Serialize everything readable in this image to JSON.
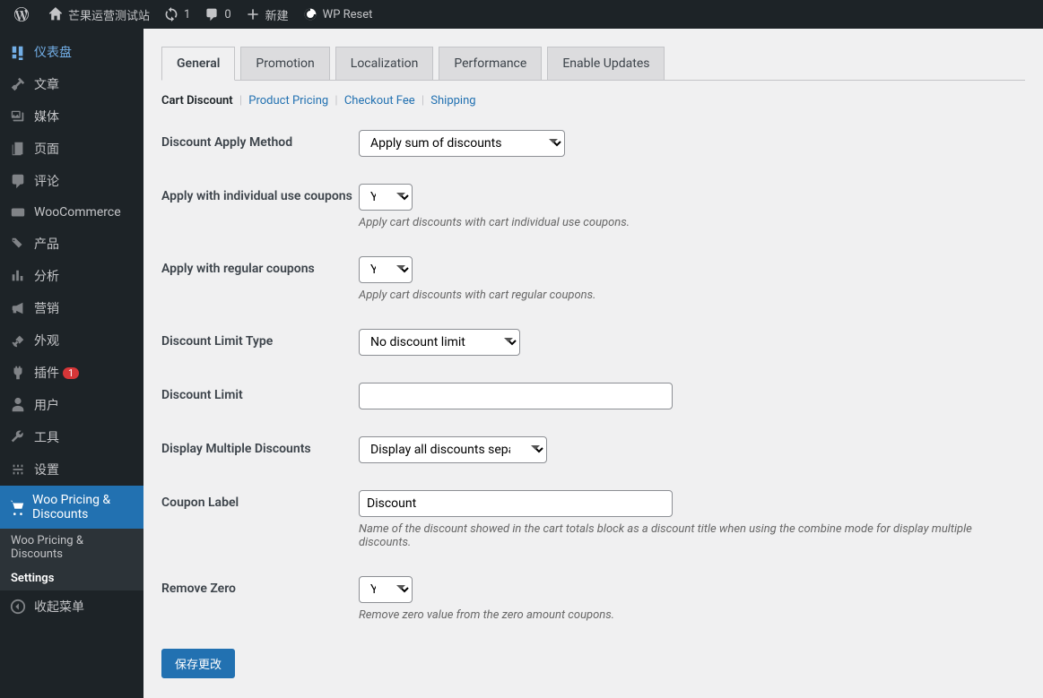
{
  "topbar": {
    "site_name": "芒果运营测试站",
    "updates_count": "1",
    "comments_count": "0",
    "new_label": "新建",
    "wp_reset": "WP Reset"
  },
  "sidebar": {
    "items": [
      {
        "label": "仪表盘"
      },
      {
        "label": "文章"
      },
      {
        "label": "媒体"
      },
      {
        "label": "页面"
      },
      {
        "label": "评论"
      },
      {
        "label": "WooCommerce"
      },
      {
        "label": "产品"
      },
      {
        "label": "分析"
      },
      {
        "label": "营销"
      },
      {
        "label": "外观"
      },
      {
        "label": "插件"
      },
      {
        "label": "用户"
      },
      {
        "label": "工具"
      },
      {
        "label": "设置"
      },
      {
        "label": "Woo Pricing & Discounts"
      }
    ],
    "plugins_badge": "1",
    "submenu": [
      {
        "label": "Woo Pricing & Discounts"
      },
      {
        "label": "Settings"
      }
    ],
    "collapse": "收起菜单"
  },
  "tabs": [
    {
      "label": "General"
    },
    {
      "label": "Promotion"
    },
    {
      "label": "Localization"
    },
    {
      "label": "Performance"
    },
    {
      "label": "Enable Updates"
    }
  ],
  "subtabs": [
    {
      "label": "Cart Discount"
    },
    {
      "label": "Product Pricing"
    },
    {
      "label": "Checkout Fee"
    },
    {
      "label": "Shipping"
    }
  ],
  "form": {
    "discount_apply_method": {
      "label": "Discount Apply Method",
      "value": "Apply sum of discounts"
    },
    "apply_individual": {
      "label": "Apply with individual use coupons",
      "value": "Yes",
      "desc": "Apply cart discounts with cart individual use coupons."
    },
    "apply_regular": {
      "label": "Apply with regular coupons",
      "value": "Yes",
      "desc": "Apply cart discounts with cart regular coupons."
    },
    "discount_limit_type": {
      "label": "Discount Limit Type",
      "value": "No discount limit"
    },
    "discount_limit": {
      "label": "Discount Limit",
      "value": ""
    },
    "display_multiple": {
      "label": "Display Multiple Discounts",
      "value": "Display all discounts separately"
    },
    "coupon_label": {
      "label": "Coupon Label",
      "value": "Discount",
      "desc": "Name of the discount showed in the cart totals block as a discount title when using the combine mode for display multiple discounts."
    },
    "remove_zero": {
      "label": "Remove Zero",
      "value": "Yes",
      "desc": "Remove zero value from the zero amount coupons."
    }
  },
  "save_button": "保存更改"
}
